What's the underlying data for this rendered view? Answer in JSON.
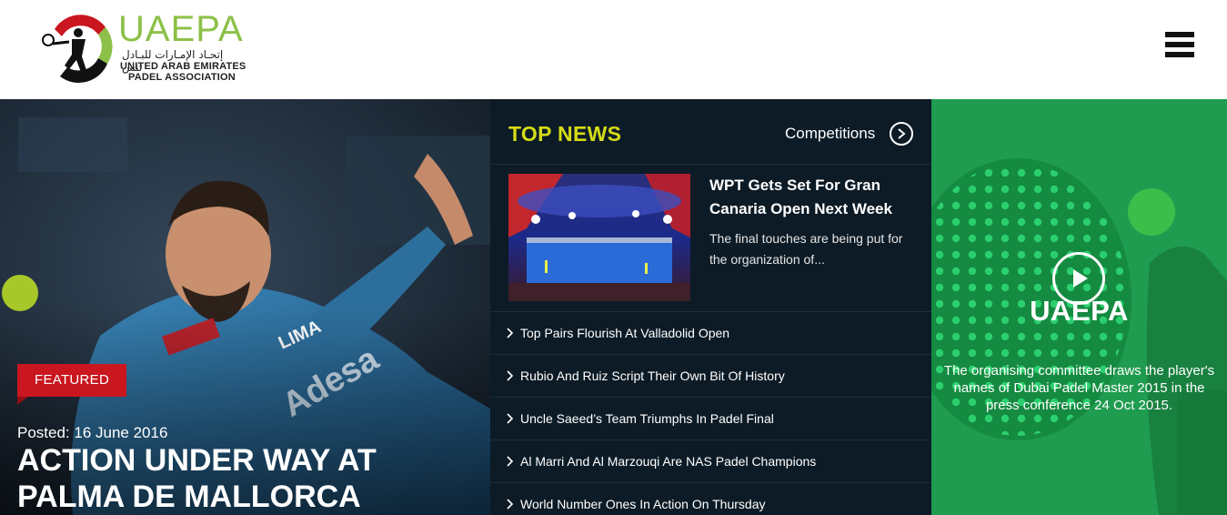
{
  "header": {
    "logo": {
      "title": "UAEPA",
      "arabic": "إتحـاد الإمـارات للبـادل تنس",
      "subtitle_line1": "UNITED ARAB EMIRATES",
      "subtitle_line2": "PADEL ASSOCIATION",
      "colors": [
        "#c9161f",
        "#8cc048",
        "#111111"
      ]
    },
    "menu_icon": "hamburger-icon"
  },
  "featured": {
    "badge": "FEATURED",
    "date": "Posted: 16 June 2016",
    "title": "ACTION UNDER WAY AT PALMA DE MALLORCA",
    "badge_color": "#c9161f"
  },
  "top_news": {
    "heading": "TOP NEWS",
    "heading_color": "#d5dc17",
    "competitions_label": "Competitions",
    "competitions_icon": "circle-chevron-right-icon",
    "lead": {
      "title": "WPT Gets Set For Gran Canaria Open Next Week",
      "excerpt": "The final touches are being put for the organization of..."
    },
    "items": [
      "Top Pairs Flourish At Valladolid Open",
      "Rubio And Ruiz Script Their Own Bit Of History",
      "Uncle Saeed’s Team Triumphs In Padel Final",
      "Al Marri And Al Marzouqi Are NAS Padel Champions",
      "World Number Ones In Action On Thursday"
    ]
  },
  "video": {
    "brand": "UAEPA",
    "caption": "The organising committee draws the player's names of Dubai Padel Master 2015 in the press conference 24 Oct 2015.",
    "play_icon": "play-icon",
    "panel_color": "#1f9c4f"
  }
}
